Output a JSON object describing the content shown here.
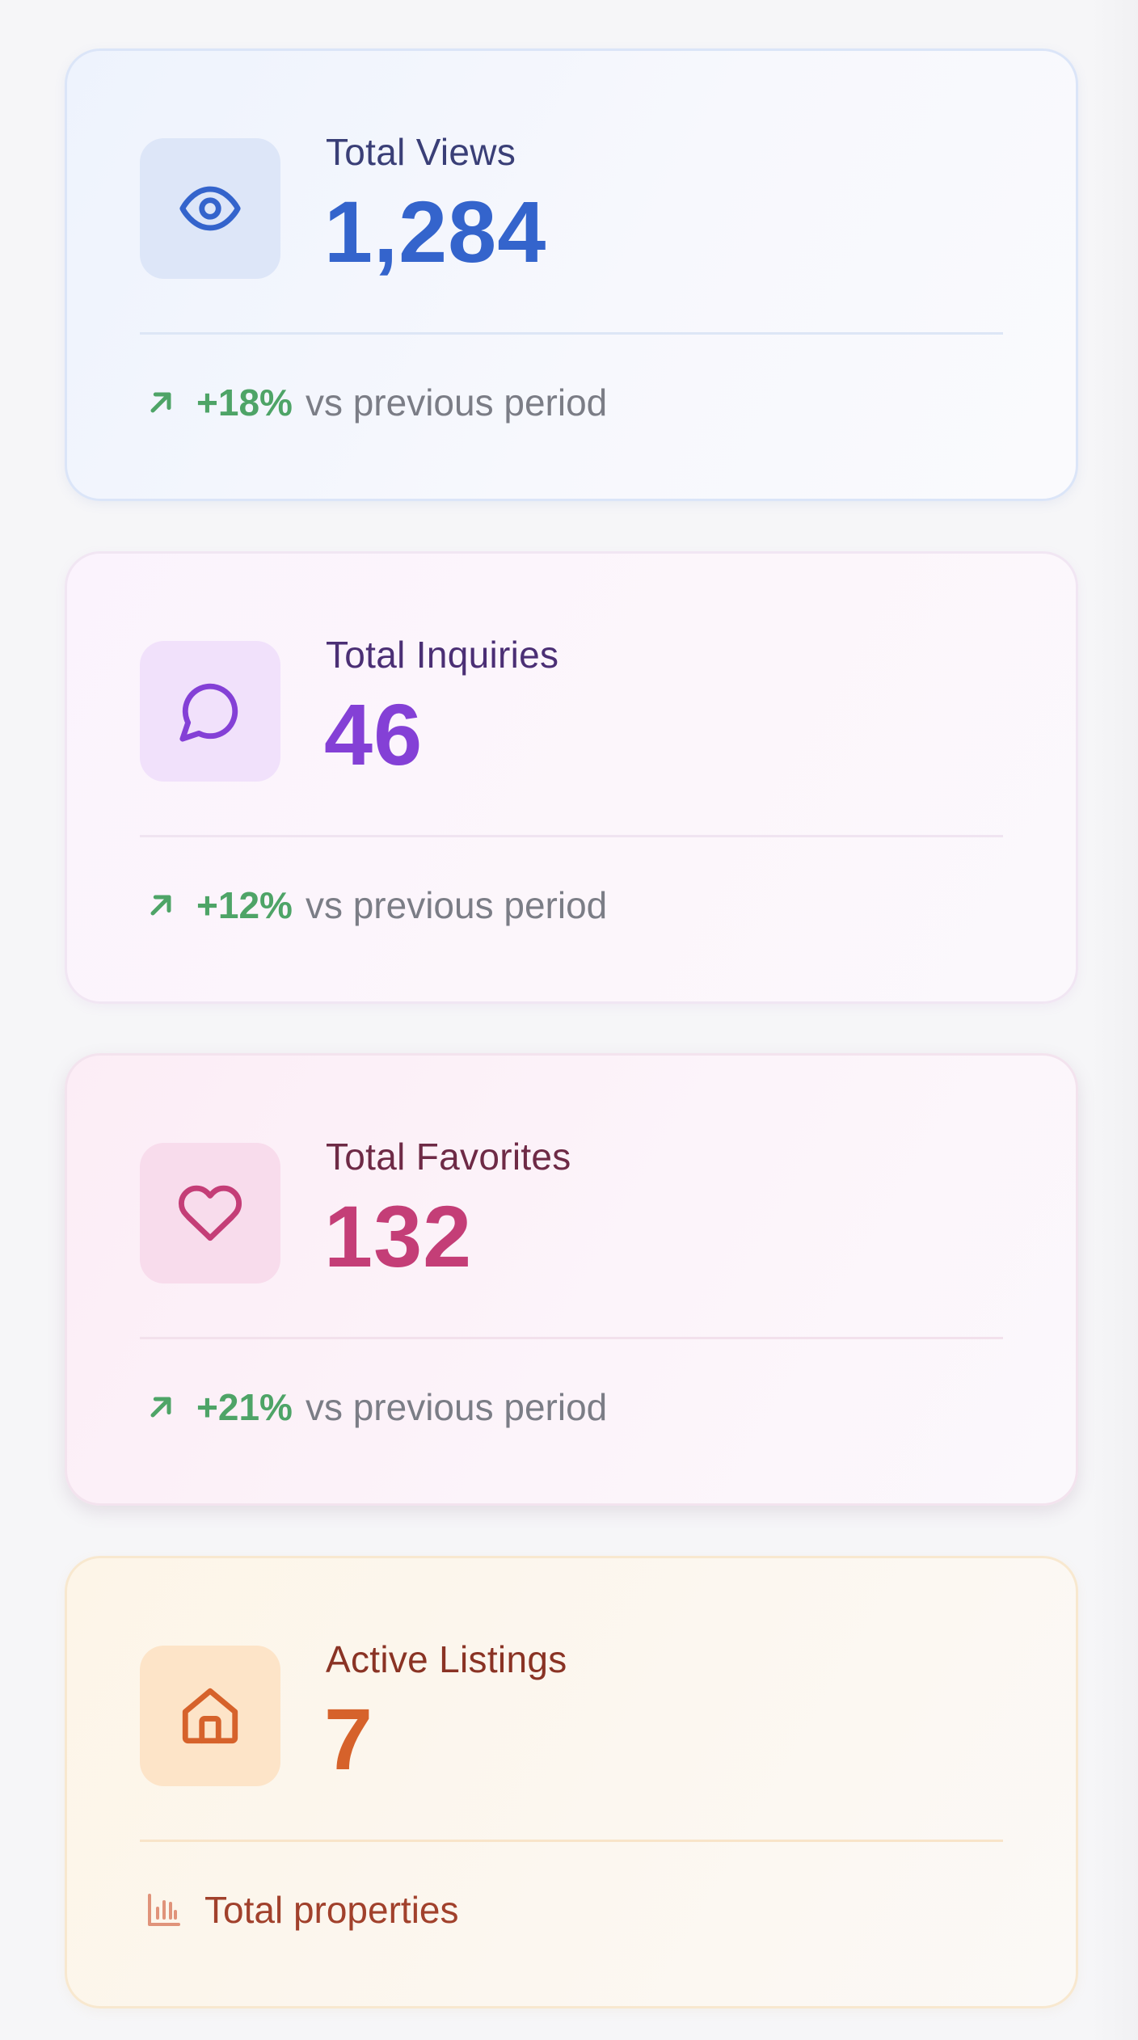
{
  "cards": [
    {
      "label": "Total Views",
      "value": "1,284",
      "icon": "eye-icon",
      "change": "+18%",
      "note": "vs previous period",
      "accent": "#3464cc"
    },
    {
      "label": "Total Inquiries",
      "value": "46",
      "icon": "message-circle-icon",
      "change": "+12%",
      "note": "vs previous period",
      "accent": "#8440d6"
    },
    {
      "label": "Total Favorites",
      "value": "132",
      "icon": "heart-icon",
      "change": "+21%",
      "note": "vs previous period",
      "accent": "#c43e77"
    },
    {
      "label": "Active Listings",
      "value": "7",
      "icon": "home-icon",
      "note": "Total properties",
      "accent": "#d6622b"
    }
  ],
  "colors": {
    "trend_up": "#4ea467",
    "muted_text": "#7b7d86"
  }
}
